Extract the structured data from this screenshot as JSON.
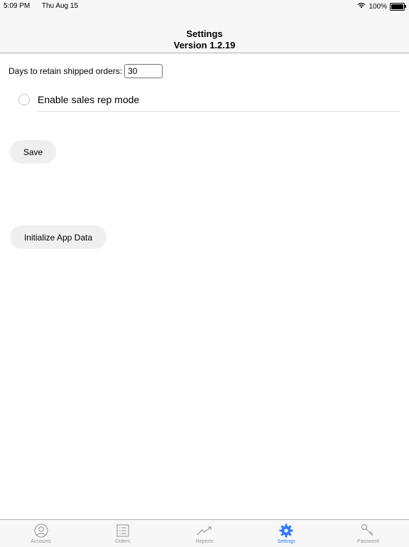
{
  "status_bar": {
    "time": "5:09 PM",
    "date": "Thu Aug 15",
    "battery": "100%",
    "battery_level": 1.0
  },
  "nav": {
    "title": "Settings",
    "subtitle": "Version 1.2.19"
  },
  "settings": {
    "retain_label": "Days to retain shipped orders:",
    "retain_value": "30",
    "sales_rep_label": "Enable sales rep mode",
    "sales_rep_enabled": false,
    "save_label": "Save",
    "init_label": "Initialize App Data"
  },
  "tabs": [
    {
      "label": "Accounts",
      "icon": "person-circle-icon",
      "active": false
    },
    {
      "label": "Orders",
      "icon": "list-icon",
      "active": false
    },
    {
      "label": "Reports",
      "icon": "trend-up-icon",
      "active": false
    },
    {
      "label": "Settings",
      "icon": "gear-icon",
      "active": true
    },
    {
      "label": "Password",
      "icon": "key-icon",
      "active": false
    }
  ],
  "colors": {
    "accent": "#3478f6",
    "inactive": "#929292",
    "button_bg": "#efeff0"
  }
}
